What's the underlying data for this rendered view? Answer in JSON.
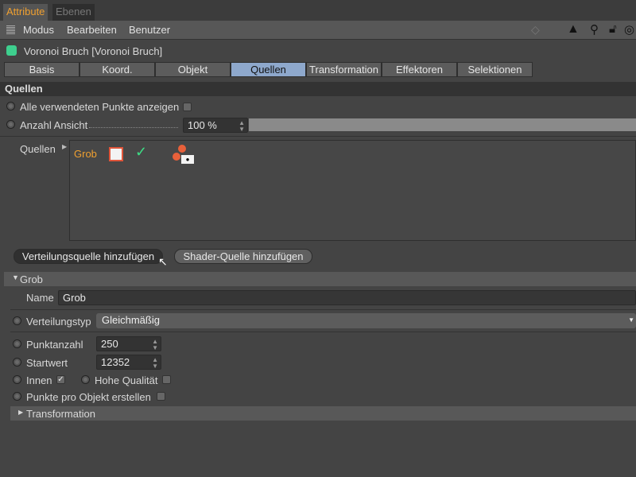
{
  "panel_tabs": [
    "Attribute",
    "Ebenen"
  ],
  "menu": [
    "Modus",
    "Bearbeiten",
    "Benutzer"
  ],
  "object_title": "Voronoi Bruch [Voronoi Bruch]",
  "tabs": [
    "Basis",
    "Koord.",
    "Objekt",
    "Quellen",
    "Transformation",
    "Effektoren",
    "Selektionen"
  ],
  "active_tab": "Quellen",
  "section_title": "Quellen",
  "show_points_label": "Alle verwendeten Punkte anzeigen",
  "view_count_label": "Anzahl Ansicht",
  "view_count_value": "100 %",
  "view_count_fraction": 1.0,
  "sources_label": "Quellen",
  "sources": [
    {
      "name": "Grob"
    }
  ],
  "buttons": {
    "add_distribution": "Verteilungsquelle hinzufügen",
    "add_shader": "Shader-Quelle hinzufügen"
  },
  "grob": {
    "header": "Grob",
    "name_label": "Name",
    "name_value": "Grob",
    "distribution_label": "Verteilungstyp",
    "distribution_value": "Gleichmäßig",
    "point_count_label": "Punktanzahl",
    "point_count_value": "250",
    "seed_label": "Startwert",
    "seed_value": "12352",
    "inside_label": "Innen",
    "inside_checked": true,
    "high_quality_label": "Hohe Qualität",
    "high_quality_checked": false,
    "per_object_label": "Punkte pro Objekt erstellen",
    "per_object_checked": false,
    "transformation_label": "Transformation"
  },
  "colors": {
    "accent": "#f0a030",
    "active_tab": "#8ea8cc",
    "check": "#3ddc84"
  }
}
